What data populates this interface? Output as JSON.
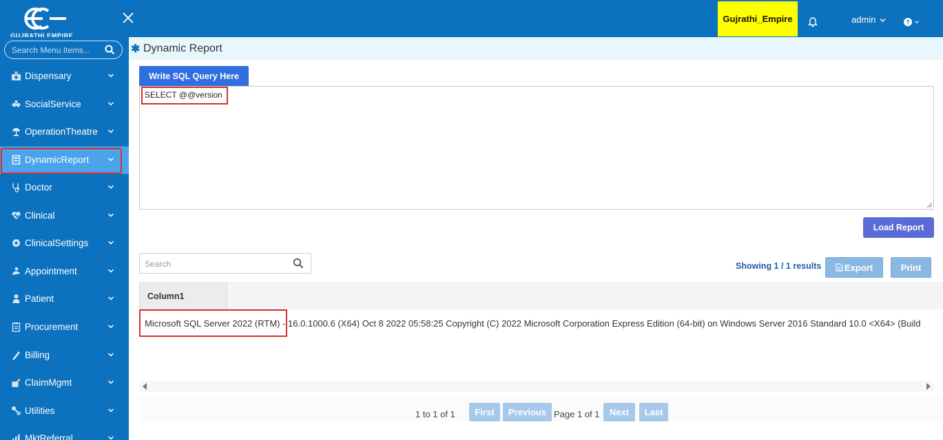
{
  "header": {
    "logo_text": "GUJRATHI EMPIRE",
    "org_name": "Gujrathi_Empire",
    "user": "admin",
    "colors": {
      "bar": "#0c71be",
      "badge": "#ffff00"
    }
  },
  "sidebar": {
    "search_placeholder": "Search Menu Items...",
    "items": [
      {
        "label": "Dispensary",
        "icon": "dispensary-icon"
      },
      {
        "label": "SocialService",
        "icon": "social-service-icon"
      },
      {
        "label": "OperationTheatre",
        "icon": "operation-theatre-icon"
      },
      {
        "label": "DynamicReport",
        "icon": "report-icon",
        "active": true
      },
      {
        "label": "Doctor",
        "icon": "stethoscope-icon"
      },
      {
        "label": "Clinical",
        "icon": "heartbeat-icon"
      },
      {
        "label": "ClinicalSettings",
        "icon": "settings-icon"
      },
      {
        "label": "Appointment",
        "icon": "appointment-icon"
      },
      {
        "label": "Patient",
        "icon": "patient-icon"
      },
      {
        "label": "Procurement",
        "icon": "clipboard-icon"
      },
      {
        "label": "Billing",
        "icon": "billing-icon"
      },
      {
        "label": "ClaimMgmt",
        "icon": "claim-icon"
      },
      {
        "label": "Utilities",
        "icon": "utilities-icon"
      },
      {
        "label": "MktReferral",
        "icon": "referral-icon"
      }
    ]
  },
  "page": {
    "title": "Dynamic Report",
    "sql_button": "Write SQL Query Here",
    "sql_query": "SELECT @@version",
    "load_button": "Load Report"
  },
  "grid": {
    "search_placeholder": "Search",
    "showing": "Showing 1 / 1 results",
    "export_label": "Export",
    "print_label": "Print",
    "columns": [
      "Column1"
    ],
    "rows": [
      [
        "Microsoft SQL Server 2022 (RTM) - 16.0.1000.6 (X64) Oct 8 2022 05:58:25 Copyright (C) 2022 Microsoft Corporation Express Edition (64-bit) on Windows Server 2016 Standard 10.0 <X64> (Build"
      ]
    ]
  },
  "pager": {
    "summary": "1 to 1 of 1",
    "first": "First",
    "previous": "Previous",
    "page_text": "Page 1 of 1",
    "next": "Next",
    "last": "Last"
  }
}
